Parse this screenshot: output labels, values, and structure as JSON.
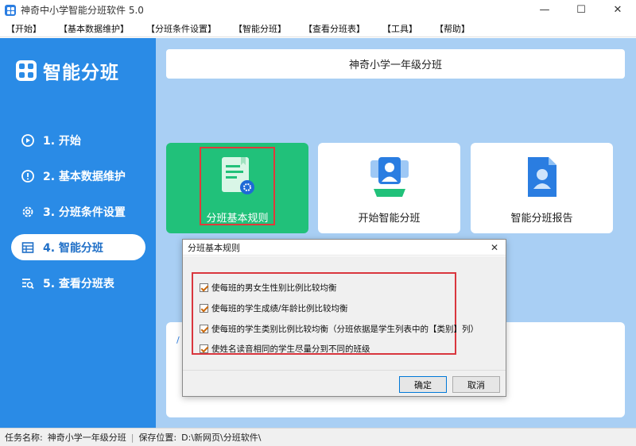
{
  "window": {
    "title": "神奇中小学智能分班软件 5.0",
    "minimize": "—",
    "maximize": "☐",
    "close": "✕"
  },
  "menu": [
    "【开始】",
    "【基本数据维护】",
    "【分班条件设置】",
    "【智能分班】",
    "【查看分班表】",
    "【工具】",
    "【帮助】"
  ],
  "sidebar": {
    "brand": "智能分班",
    "items": [
      {
        "label": "1. 开始",
        "icon": "play-circle-icon"
      },
      {
        "label": "2. 基本数据维护",
        "icon": "info-circle-icon"
      },
      {
        "label": "3. 分班条件设置",
        "icon": "gear-icon"
      },
      {
        "label": "4. 智能分班",
        "icon": "table-icon",
        "active": true
      },
      {
        "label": "5. 查看分班表",
        "icon": "list-search-icon"
      }
    ]
  },
  "header": {
    "title": "神奇小学一年级分班"
  },
  "cards": [
    {
      "label": "分班基本规则",
      "icon": "rules-document-icon"
    },
    {
      "label": "开始智能分班",
      "icon": "students-icon"
    },
    {
      "label": "智能分班报告",
      "icon": "report-document-icon"
    }
  ],
  "dialog": {
    "title": "分班基本规则",
    "close": "✕",
    "rules": [
      {
        "label": "使每班的男女生性别比例比较均衡",
        "checked": true
      },
      {
        "label": "使每班的学生成绩/年龄比例比较均衡",
        "checked": true
      },
      {
        "label": "使每班的学生类别比例比较均衡（分班依据是学生列表中的【类别】列）",
        "checked": true
      },
      {
        "label": "使姓名读音相同的学生尽量分到不同的班级",
        "checked": true
      }
    ],
    "ok": "确定",
    "cancel": "取消"
  },
  "status": {
    "task_label": "任务名称:",
    "task_value": "神奇小学一年级分班",
    "save_label": "保存位置:",
    "save_value": "D:\\新网页\\分班软件\\"
  },
  "colors": {
    "sidebar": "#2a8be6",
    "content": "#a9cff4",
    "green_card": "#21c17a",
    "highlight": "#e03a3a"
  }
}
